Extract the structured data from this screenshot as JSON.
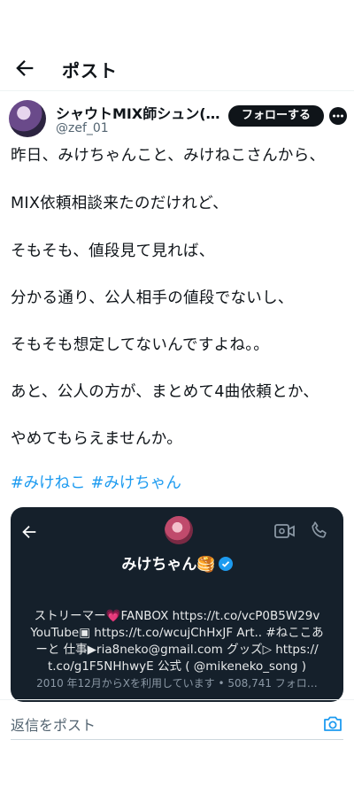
{
  "header": {
    "title": "ポスト",
    "back_icon": "back-arrow-icon"
  },
  "post": {
    "author_name": "シャウトMIX師シュン(…",
    "author_handle": "@zef_01",
    "follow_label": "フォローする",
    "lines": [
      "昨日、みけちゃんこと、みけねこさんから、",
      "MIX依頼相談来たのだけれど、",
      "そもそも、値段見て見れば、",
      "分かる通り、公人相手の値段でないし、",
      "そもそも想定してないんですよね。。",
      "あと、公人の方が、まとめて4曲依頼とか、",
      "やめてもらえませんか。"
    ],
    "hashtags": [
      "#みけねこ",
      "#みけちゃん"
    ]
  },
  "embed": {
    "name": "みけちゃん🥞",
    "bio_lines": [
      "ストリーマー💗FANBOX https://t.co/vcP0B5W29v",
      "YouTube▣ https://t.co/wcujChHxJF Art.. #ねここあ",
      "ーと 仕事▶ria8neko@gmail.com グッズ▷ https://",
      "t.co/g1F5NHhwyE 公式 ( @mikeneko_song )"
    ],
    "footer": "2010 年12月からXを利用しています • 508,741 フォロ…"
  },
  "reply": {
    "placeholder": "返信をポスト"
  },
  "colors": {
    "link": "#1d9bf0",
    "card_bg": "#15202b",
    "button_bg": "#0f1419"
  }
}
